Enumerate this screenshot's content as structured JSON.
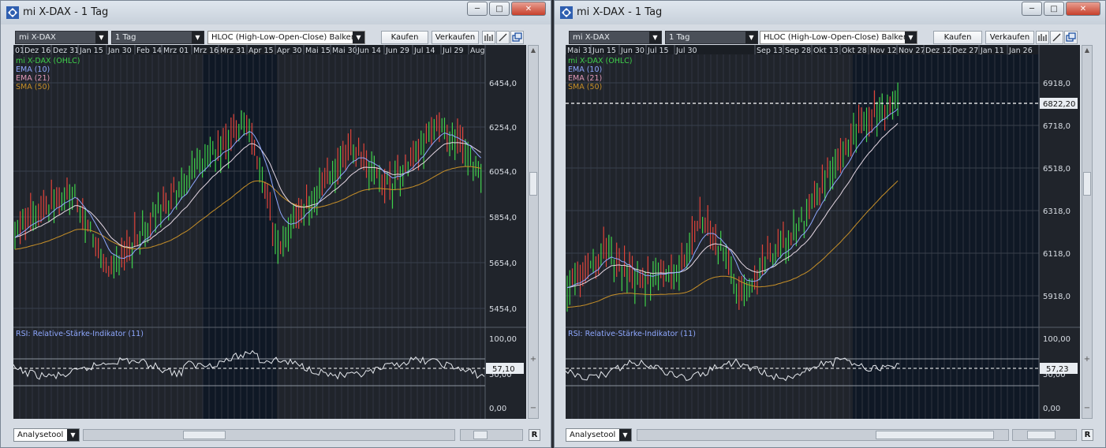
{
  "windows": [
    {
      "title": "mi X-DAX - 1 Tag",
      "toolbar": {
        "instrument": "mi X-DAX",
        "interval": "1 Tag",
        "chart_type": "HLOC (High-Low-Open-Close) Balken",
        "buy_label": "Kaufen",
        "sell_label": "Verkaufen"
      },
      "date_labels": [
        "01",
        "Dez 16",
        "Dez 31",
        "Jan 15",
        "Jan 30",
        "Feb 14",
        "Mrz 01",
        "Mrz 16",
        "Mrz 31",
        "Apr 15",
        "Apr 30",
        "Mai 15",
        "Mai 30",
        "Jun 14",
        "Jun 29",
        "Jul 14",
        "Jul 29",
        "Aug"
      ],
      "legend": [
        {
          "text": "mi X-DAX (OHLC)",
          "color": "#3fd14a"
        },
        {
          "text": "EMA (10)",
          "color": "#8fa8ff"
        },
        {
          "text": "EMA (21)",
          "color": "#e39ab8"
        },
        {
          "text": "SMA (50)",
          "color": "#c89028"
        }
      ],
      "price_axis": [
        "6454,0",
        "6254,0",
        "6054,0",
        "5854,0",
        "5654,0",
        "5454,0"
      ],
      "rsi": {
        "title": "RSI: Relative-Stärke-Indikator (11)",
        "axis": [
          "100,00",
          "0,00"
        ],
        "value": "57,10",
        "axis_partial": "50,00"
      },
      "analysetool_label": "Analysetool",
      "r_button": "R"
    },
    {
      "title": "mi X-DAX - 1 Tag",
      "toolbar": {
        "instrument": "mi X-DAX",
        "interval": "1 Tag",
        "chart_type": "HLOC (High-Low-Open-Close) Balken",
        "buy_label": "Kaufen",
        "sell_label": "Verkaufen"
      },
      "date_labels": [
        "Mai 31",
        "Jun 15",
        "Jun 30",
        "Jul 15",
        "Jul 30",
        "Sep 13",
        "Sep 28",
        "Okt 13",
        "Okt 28",
        "Nov 12",
        "Nov 27",
        "Dez 12",
        "Dez 27",
        "Jan 11",
        "Jan 26"
      ],
      "legend": [
        {
          "text": "mi X-DAX (OHLC)",
          "color": "#3fd14a"
        },
        {
          "text": "EMA (10)",
          "color": "#8fa8ff"
        },
        {
          "text": "EMA (21)",
          "color": "#e39ab8"
        },
        {
          "text": "SMA (50)",
          "color": "#c89028"
        }
      ],
      "price_axis": [
        "6918,0",
        "6718,0",
        "6518,0",
        "6318,0",
        "6118,0",
        "5918,0"
      ],
      "current_price": "6822,20",
      "rsi": {
        "title": "RSI: Relative-Stärke-Indikator (11)",
        "axis": [
          "100,00",
          "0,00"
        ],
        "value": "57,23",
        "axis_partial": "50,00"
      },
      "analysetool_label": "Analysetool",
      "r_button": "R"
    }
  ],
  "colors": {
    "up": "#3fd14a",
    "down": "#e0443a",
    "ema10": "#8fa8ff",
    "ema21": "#e6d8e4",
    "sma50": "#c89028",
    "panel_bg": "#20242b",
    "highlight_bg": "#0f1a2a"
  }
}
